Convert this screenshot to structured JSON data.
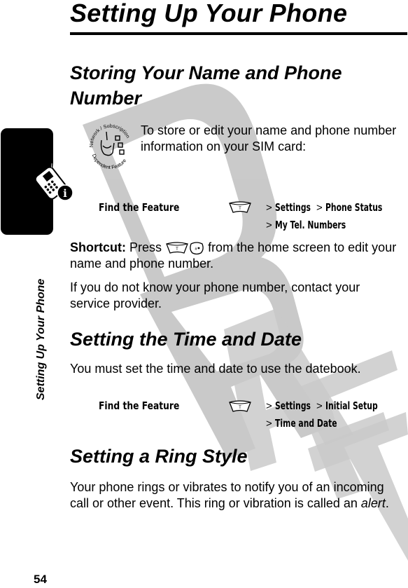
{
  "page": {
    "title": "Setting Up Your Phone",
    "side_tab_label": "Setting Up Your Phone",
    "page_number": "54",
    "watermark": "DRAFT"
  },
  "sections": [
    {
      "heading_line1": "Storing Your Name and Phone",
      "heading_line2": "Number",
      "badge_label": "Network / Subscription Dependent Feature",
      "intro_line1": "To store or edit your name and phone number",
      "intro_line2": "information on your SIM card:",
      "find_feature": {
        "label": "Find the Feature",
        "key_icon": "menu-key",
        "path": [
          [
            "Settings",
            "Phone Status"
          ],
          [
            "My Tel. Numbers"
          ]
        ]
      },
      "shortcut_label": "Shortcut:",
      "shortcut_press": "Press",
      "shortcut_keys": [
        "menu-key",
        "hash-key"
      ],
      "shortcut_rest1": "from the home screen to edit your",
      "shortcut_rest2": "name and phone number.",
      "note_line1": "If you do not know your phone number, contact your",
      "note_line2": "service provider."
    },
    {
      "heading": "Setting the Time and Date",
      "body": "You must set the time and date to use the datebook.",
      "find_feature": {
        "label": "Find the Feature",
        "key_icon": "menu-key",
        "path": [
          [
            "Settings",
            "Initial Setup"
          ],
          [
            "Time and Date"
          ]
        ]
      }
    },
    {
      "heading": "Setting a Ring Style",
      "body_line1": "Your phone rings or vibrates to notify you of an incoming",
      "body_line2_prefix": "call or other event. This ring or vibration is called an ",
      "body_line2_term": "alert",
      "body_line2_suffix": "."
    }
  ],
  "separators": {
    "gt": ">"
  }
}
